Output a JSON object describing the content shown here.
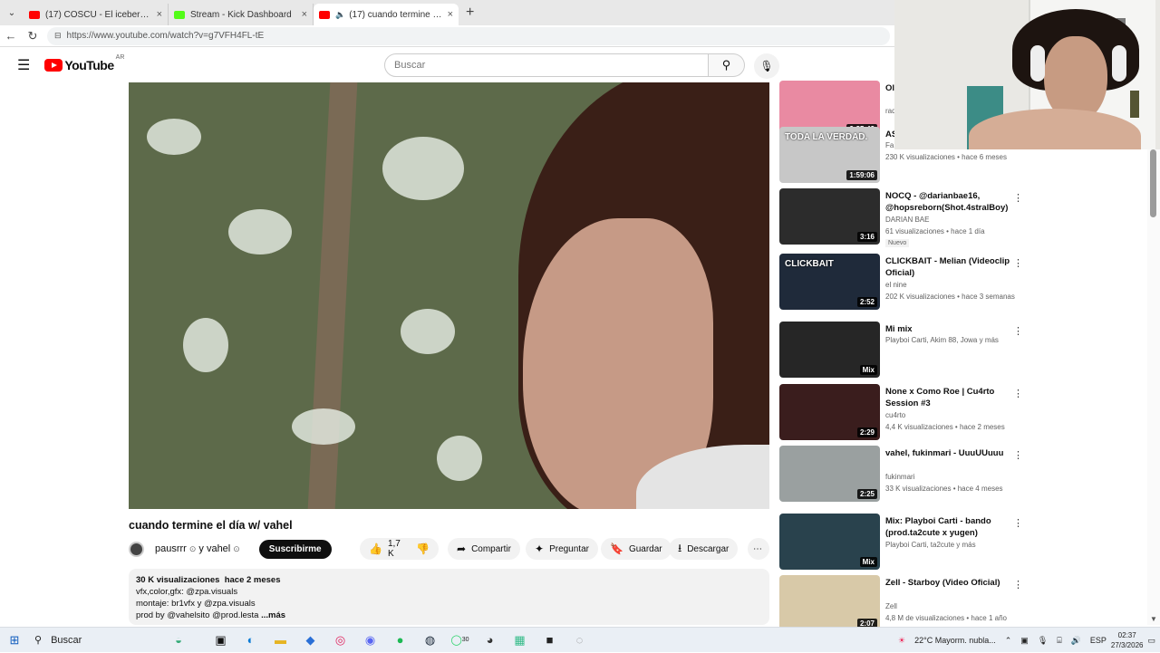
{
  "browser": {
    "tabs": [
      {
        "title": "(17) COSCU - El iceberg Argentina",
        "favicon_color": "#ff0000"
      },
      {
        "title": "Stream - Kick Dashboard",
        "favicon_color": "#53fc18"
      },
      {
        "title": "(17) cuando termine el día w/",
        "favicon_color": "#ff0000"
      }
    ],
    "url": "https://www.youtube.com/watch?v=g7VFH4FL-tE"
  },
  "youtube": {
    "logo_text": "YouTube",
    "country_code": "AR",
    "search_placeholder": "Buscar"
  },
  "video": {
    "title": "cuando termine el día w/ vahel",
    "channel": "pausrrr",
    "collab": "y vahel",
    "subscribe_label": "Suscribirme",
    "likes": "1,7 K",
    "share_label": "Compartir",
    "ask_label": "Preguntar",
    "save_label": "Guardar",
    "download_label": "Descargar",
    "more_icon": "more-horizontal-icon"
  },
  "description": {
    "views": "30 K visualizaciones",
    "age": "hace 2 meses",
    "lines": [
      "vfx,color,gfx: @zpa.visuals",
      "montaje: br1vfx y @zpa.visuals"
    ],
    "last_line": "prod by @vahelsito @prod.lesta",
    "more_label": "...más"
  },
  "recommendations": [
    {
      "title": "Ol",
      "channel": "",
      "meta": "rad",
      "duration": "2:35:43",
      "thumb_color": "#e98aa2"
    },
    {
      "title": "AS",
      "channel": "Fa",
      "meta": "230 K visualizaciones • hace 6 meses",
      "duration": "1:59:06",
      "thumb_color": "#c7c7c7",
      "thumb_text": "TODA LA VERDAD."
    },
    {
      "title": "NOCQ - @darianbae16, @hopsreborn(Shot.4stralBoy)",
      "channel": "DARIAN BAE",
      "meta": "61 visualizaciones • hace 1 día",
      "badge": "Nuevo",
      "duration": "3:16",
      "thumb_color": "#2c2c2c"
    },
    {
      "title": "CLICKBAIT - Melian (Videoclip Oficial)",
      "channel": "el nine",
      "meta": "202 K visualizaciones • hace 3 semanas",
      "duration": "2:52",
      "thumb_color": "#1f2a3a",
      "thumb_text": "CLICKBAIT"
    },
    {
      "title": "Mi mix",
      "channel": "Playboi Carti, Akim 88, Jowa y más",
      "meta": "",
      "duration": "Mix",
      "thumb_color": "#262626"
    },
    {
      "title": "None x Como Roe | Cu4rto Session #3",
      "channel": "cu4rto",
      "meta": "4,4 K visualizaciones • hace 2 meses",
      "duration": "2:29",
      "thumb_color": "#3a1d1d"
    },
    {
      "title": "vahel, fukinmari - UuuUUuuu",
      "channel": "fukinmari",
      "meta": "33 K visualizaciones • hace 4 meses",
      "duration": "2:25",
      "thumb_color": "#9aa0a0"
    },
    {
      "title": "Mix: Playboi Carti - bando (prod.ta2cute x yugen)",
      "channel": "Playboi Carti, ta2cute y más",
      "meta": "",
      "duration": "Mix",
      "thumb_color": "#29424d"
    },
    {
      "title": "Zell - Starboy (Video Oficial)",
      "channel": "Zell",
      "meta": "4,8 M de visualizaciones • hace 1 año",
      "duration": "2:07",
      "thumb_color": "#d8c9a8"
    }
  ],
  "taskbar": {
    "search_label": "Buscar",
    "weather": "22°C  Mayorm. nubla...",
    "lang": "ESP",
    "time": "02:37",
    "date": "27/3/2026",
    "whatsapp_badge": "30"
  }
}
